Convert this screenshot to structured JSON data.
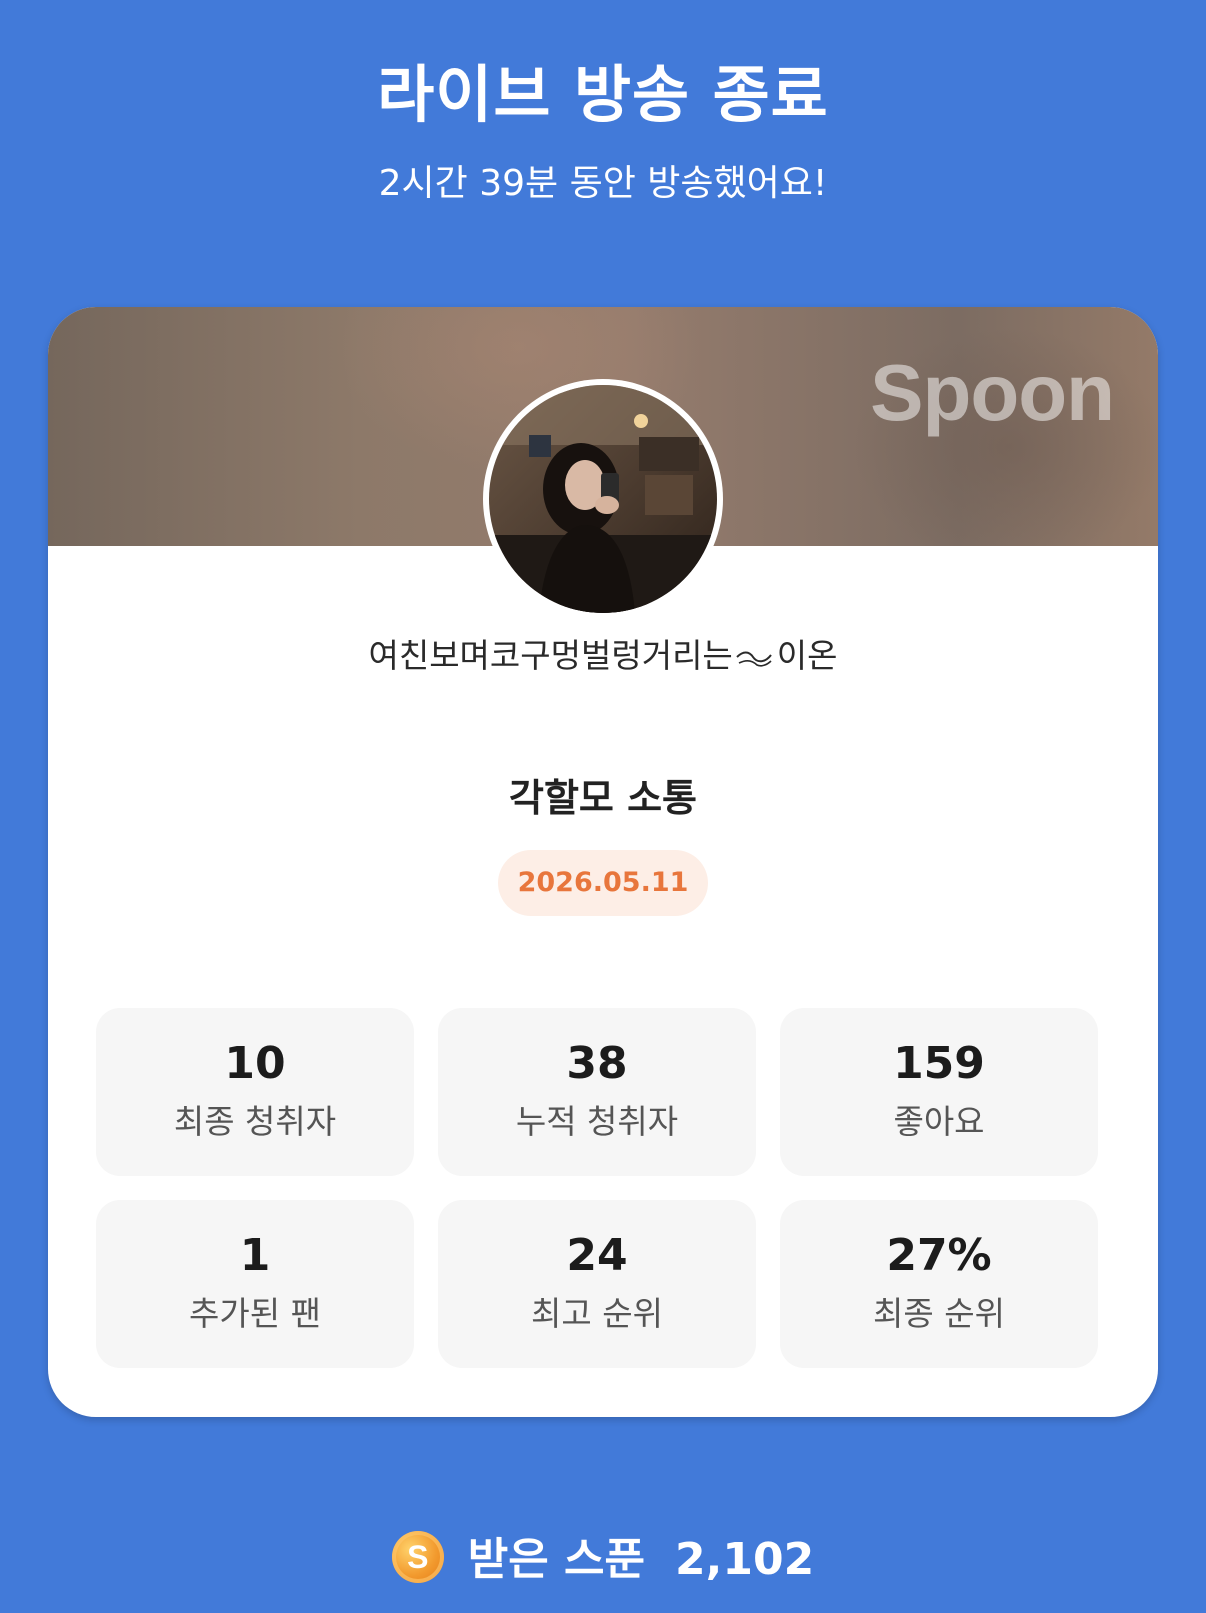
{
  "header": {
    "title": "라이브 방송 종료",
    "subtitle": "2시간 39분 동안 방송했어요!"
  },
  "card": {
    "brand": "Spoon",
    "nickname_prefix": "여친보며코구멍벌렁거리는",
    "nickname_suffix": "이온",
    "live_title": "각할모 소통",
    "date": "2026.05.11",
    "stats": [
      {
        "value": "10",
        "label": "최종 청취자"
      },
      {
        "value": "38",
        "label": "누적 청취자"
      },
      {
        "value": "159",
        "label": "좋아요"
      },
      {
        "value": "1",
        "label": "추가된 팬"
      },
      {
        "value": "24",
        "label": "최고 순위"
      },
      {
        "value": "27%",
        "label": "최종 순위"
      }
    ]
  },
  "footer": {
    "coin_symbol": "S",
    "spoon_label": "받은 스푼",
    "spoon_value": "2,102"
  },
  "colors": {
    "background": "#427ad9",
    "date_badge_bg": "#fdeee6",
    "date_badge_text": "#e8763c",
    "stat_tile_bg": "#f6f6f6"
  },
  "icons": {
    "coin": "spoon-coin-icon",
    "nickname_decoration": "wave-swirl-icon"
  }
}
